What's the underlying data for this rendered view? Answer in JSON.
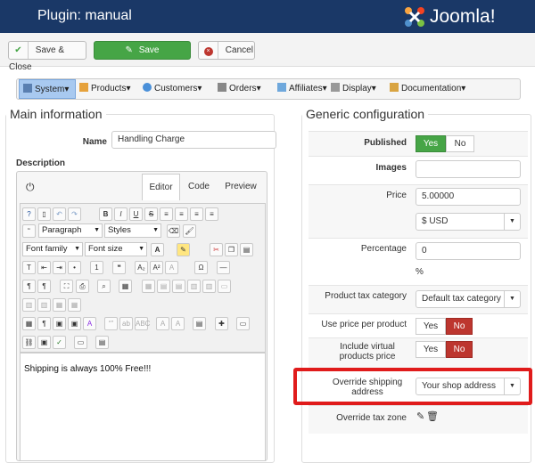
{
  "header": {
    "title": "Plugin: manual",
    "logo_text": "Joomla!"
  },
  "toolbar": {
    "save_close": "Save & Close",
    "save": "Save",
    "cancel": "Cancel"
  },
  "menu": [
    {
      "label": "System",
      "icon": "wrench-icon"
    },
    {
      "label": "Products",
      "icon": "box-icon"
    },
    {
      "label": "Customers",
      "icon": "users-icon"
    },
    {
      "label": "Orders",
      "icon": "cart-icon"
    },
    {
      "label": "Affiliates",
      "icon": "affiliates-icon"
    },
    {
      "label": "Display",
      "icon": "display-icon"
    },
    {
      "label": "Documentation",
      "icon": "documentation-icon"
    }
  ],
  "main": {
    "legend": "Main information",
    "name_label": "Name",
    "name_value": "Handling Charge",
    "description_label": "Description",
    "tabs": [
      "Editor",
      "Code",
      "Preview"
    ],
    "editor": {
      "paragraph": "Paragraph",
      "styles": "Styles",
      "font_family": "Font family",
      "font_size": "Font size",
      "content": "Shipping is always 100% Free!!!"
    }
  },
  "generic": {
    "legend": "Generic configuration",
    "published": {
      "label": "Published",
      "yes": "Yes",
      "no": "No"
    },
    "images": {
      "label": "Images"
    },
    "price": {
      "label": "Price",
      "value": "5.00000",
      "currency": "$ USD"
    },
    "percentage": {
      "label": "Percentage",
      "value": "0",
      "unit": "%"
    },
    "tax_category": {
      "label": "Product tax category",
      "value": "Default tax category"
    },
    "use_price": {
      "label": "Use price per product",
      "yes": "Yes",
      "no": "No"
    },
    "include_virtual": {
      "label": "Include virtual products price",
      "yes": "Yes",
      "no": "No"
    },
    "override_shipping": {
      "label": "Override shipping address",
      "value": "Your shop address"
    },
    "override_tax": {
      "label": "Override tax zone"
    }
  },
  "colors": {
    "header": "#1a3867",
    "green": "#46a546",
    "red": "#bd362f",
    "highlight": "#e01b1b"
  }
}
